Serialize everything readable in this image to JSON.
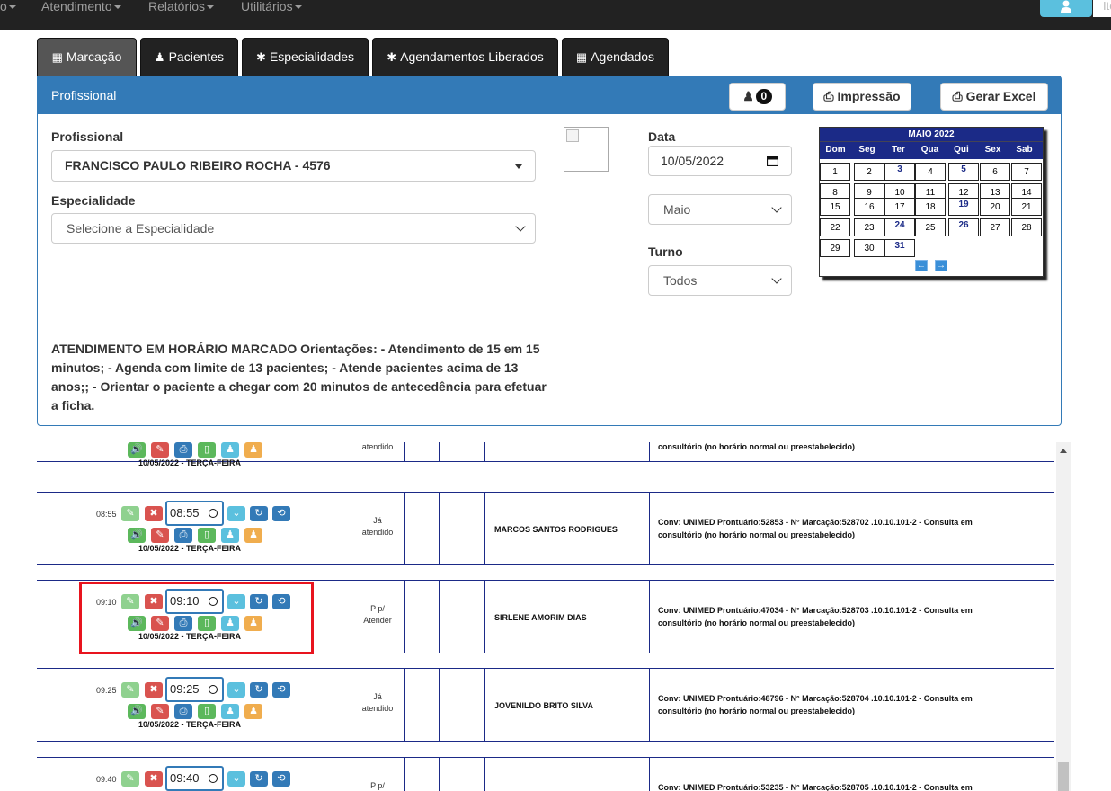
{
  "nav": {
    "items": [
      {
        "label": "o"
      },
      {
        "label": "Atendimento"
      },
      {
        "label": "Relatórios"
      },
      {
        "label": "Utilitários"
      }
    ],
    "search_placeholder": "Ite"
  },
  "tabs": [
    {
      "label": "Marcação",
      "icon": "calendar-icon"
    },
    {
      "label": "Pacientes",
      "icon": "user-icon"
    },
    {
      "label": "Especialidades",
      "icon": "asterisk-icon"
    },
    {
      "label": "Agendamentos Liberados",
      "icon": "asterisk-icon"
    },
    {
      "label": "Agendados",
      "icon": "calendar-icon"
    }
  ],
  "panel": {
    "title": "Profissional",
    "counter": "0",
    "print_label": "Impressão",
    "excel_label": "Gerar Excel"
  },
  "form": {
    "profissional_label": "Profissional",
    "profissional_value": "FRANCISCO PAULO RIBEIRO ROCHA - 4576",
    "especialidade_label": "Especialidade",
    "especialidade_value": "Selecione a Especialidade",
    "data_label": "Data",
    "data_value": "10/05/2022",
    "mes_value": "Maio",
    "turno_label": "Turno",
    "turno_value": "Todos",
    "notes": "ATENDIMENTO EM HORÁRIO MARCADO Orientações: - Atendimento de 15 em 15 minutos; - Agenda com limite de 13 pacientes; - Atende pacientes acima de 13 anos;; - Orientar o paciente a chegar com 20 minutos de antecedência para efetuar a ficha."
  },
  "calendar": {
    "title": "MAIO 2022",
    "weekdays": [
      "Dom",
      "Seg",
      "Ter",
      "Qua",
      "Qui",
      "Sex",
      "Sab"
    ],
    "weeks": [
      [
        "1",
        "2",
        "3",
        "4",
        "5",
        "6",
        "7"
      ],
      [
        "8",
        "9",
        "10",
        "11",
        "12",
        "13",
        "14"
      ],
      [
        "15",
        "16",
        "17",
        "18",
        "19",
        "20",
        "21"
      ],
      [
        "22",
        "23",
        "24",
        "25",
        "26",
        "27",
        "28"
      ],
      [
        "29",
        "30",
        "31",
        "",
        "",
        "",
        ""
      ]
    ],
    "highlighted": [
      "3",
      "5",
      "19",
      "24",
      "26",
      "31"
    ],
    "prev": "←",
    "next": "→"
  },
  "appointments": [
    {
      "time": "",
      "input_time": "",
      "date": "10/05/2022 - TERÇA-FEIRA",
      "status": [
        "atendido"
      ],
      "patient": "",
      "conv": [
        "consultório (no horário normal ou preestabelecido)"
      ]
    },
    {
      "time": "08:55",
      "input_time": "08:55",
      "date": "10/05/2022 - TERÇA-FEIRA",
      "status": [
        "Já",
        "atendido"
      ],
      "patient": "MARCOS SANTOS RODRIGUES",
      "conv": [
        "Conv: UNIMED Prontuário:52853 - N° Marcação:528702 .10.10.101-2 - Consulta em",
        "consultório (no horário normal ou preestabelecido)"
      ]
    },
    {
      "time": "09:10",
      "input_time": "09:10",
      "date": "10/05/2022 - TERÇA-FEIRA",
      "status": [
        "P p/",
        "Atender"
      ],
      "patient": "SIRLENE AMORIM DIAS",
      "conv": [
        "Conv: UNIMED Prontuário:47034 - N° Marcação:528703 .10.10.101-2 - Consulta em",
        "consultório (no horário normal ou preestabelecido)"
      ]
    },
    {
      "time": "09:25",
      "input_time": "09:25",
      "date": "10/05/2022 - TERÇA-FEIRA",
      "status": [
        "Já",
        "atendido"
      ],
      "patient": "JOVENILDO BRITO SILVA",
      "conv": [
        "Conv: UNIMED Prontuário:48796 - N° Marcação:528704 .10.10.101-2 - Consulta em",
        "consultório (no horário normal ou preestabelecido)"
      ]
    },
    {
      "time": "09:40",
      "input_time": "09:40",
      "date": "",
      "status": [
        "P p/",
        ""
      ],
      "patient": "",
      "conv": [
        "Conv: UNIMED Prontuário:53235 - N° Marcação:528705 .10.10.101-2 - Consulta em",
        ""
      ]
    }
  ]
}
